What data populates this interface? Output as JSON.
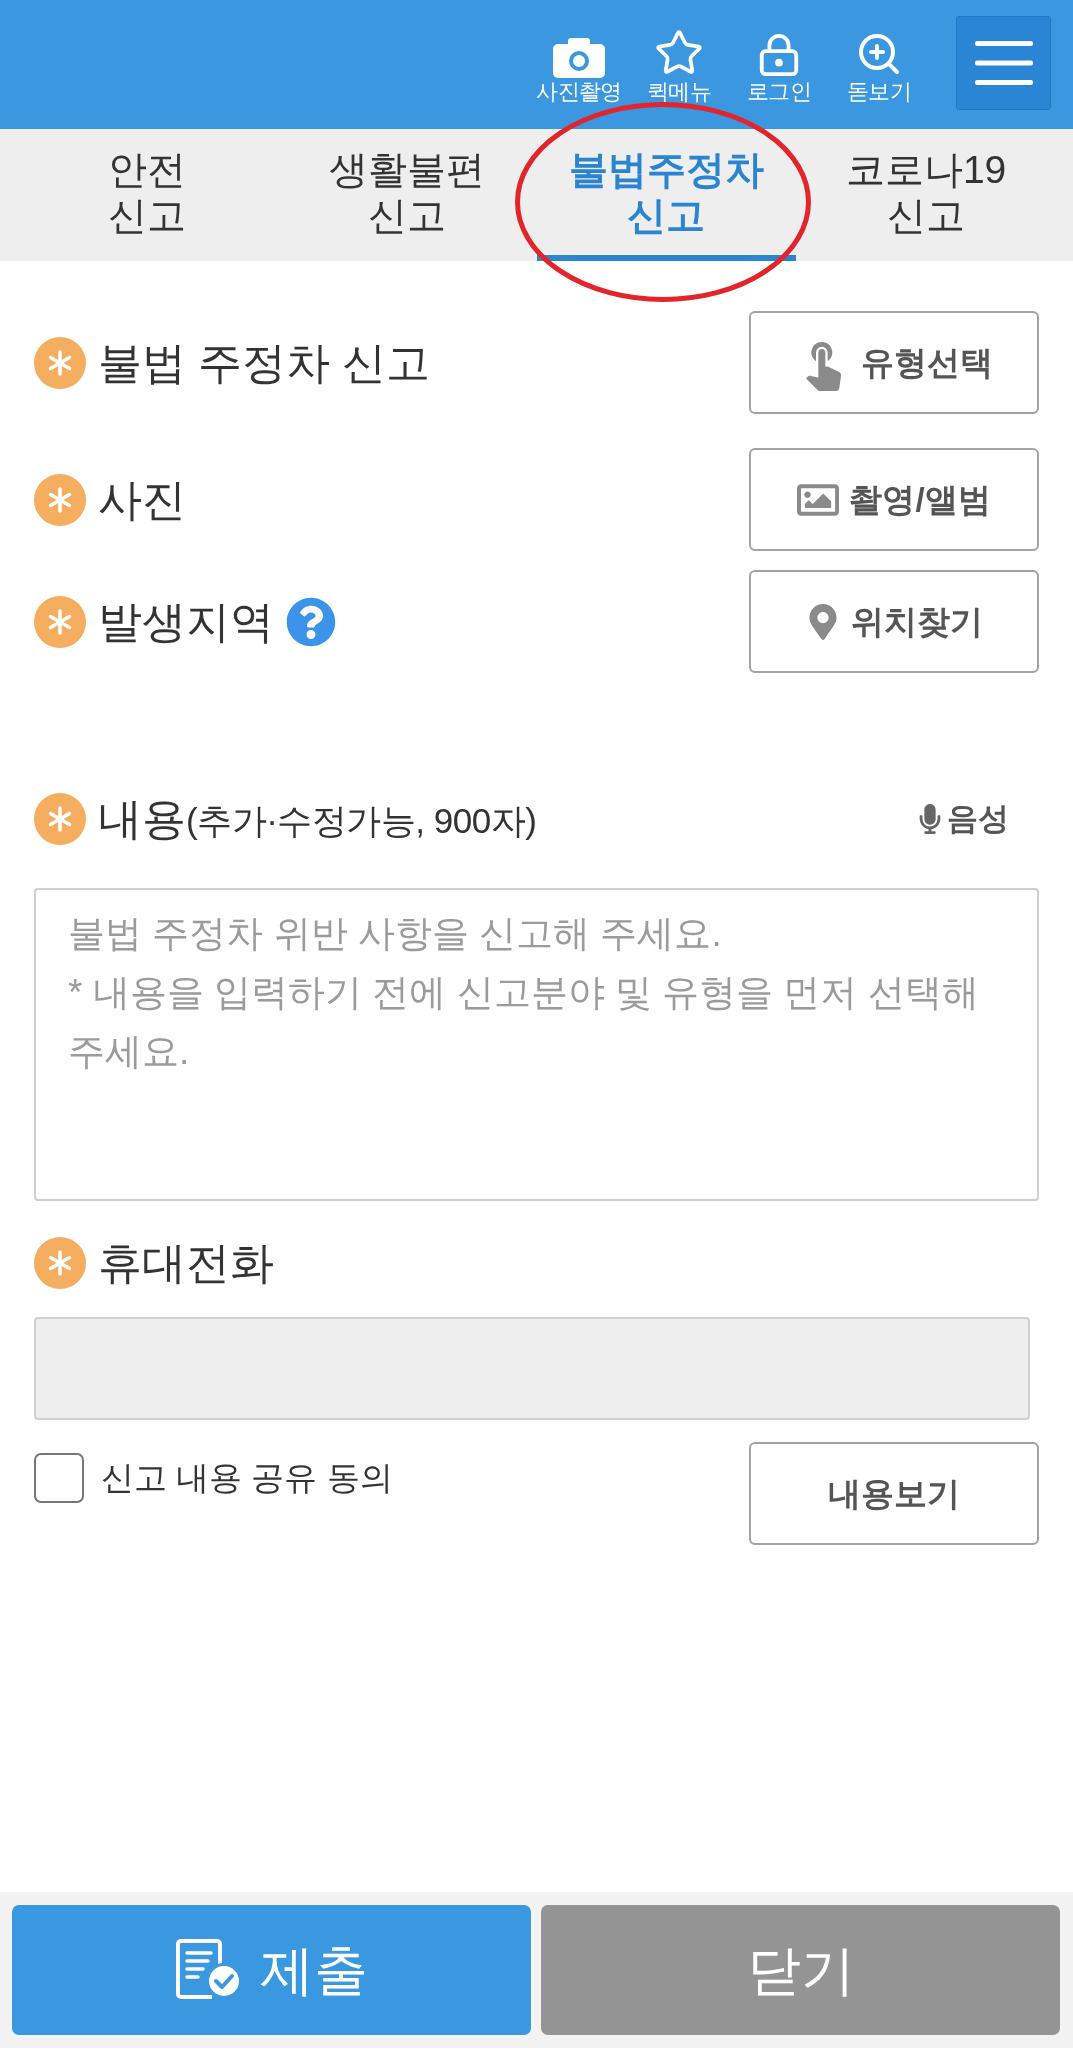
{
  "header": {
    "actions": [
      {
        "kind": "camera",
        "label": "사진촬영"
      },
      {
        "kind": "star",
        "label": "퀵메뉴"
      },
      {
        "kind": "lock",
        "label": "로그인"
      },
      {
        "kind": "zoom",
        "label": "돋보기"
      }
    ]
  },
  "tabs": [
    {
      "label": "안전\n신고",
      "selected": false
    },
    {
      "label": "생활불편\n신고",
      "selected": false
    },
    {
      "label": "불법주정차\n신고",
      "selected": true
    },
    {
      "label": "코로나19\n신고",
      "selected": false
    }
  ],
  "form": {
    "fields": [
      {
        "label": "불법 주정차 신고",
        "required": true,
        "help": false,
        "button": {
          "kind": "tap",
          "label": "유형선택"
        }
      },
      {
        "label": "사진",
        "required": true,
        "help": false,
        "button": {
          "kind": "image",
          "label": "촬영/앨범"
        }
      },
      {
        "label": "발생지역",
        "required": true,
        "help": true,
        "button": {
          "kind": "pin",
          "label": "위치찾기"
        }
      }
    ],
    "content": {
      "label": "내용",
      "note": "(추가·수정가능, 900자)",
      "required": true,
      "voice_button": {
        "label": "음성"
      },
      "placeholder": "불법 주정차 위반 사항을 신고해 주세요.\n* 내용을 입력하기 전에 신고분야 및 유형을 먼저 선택해 주세요."
    },
    "phone": {
      "label": "휴대전화",
      "required": true,
      "disabled": true
    },
    "consent": {
      "label": "신고 내용 공유 동의",
      "checked": false,
      "button": {
        "label": "내용보기"
      }
    }
  },
  "footer": {
    "buttons": [
      {
        "kind": "submit",
        "label": "제출"
      },
      {
        "kind": "close",
        "label": "닫기"
      }
    ]
  }
}
